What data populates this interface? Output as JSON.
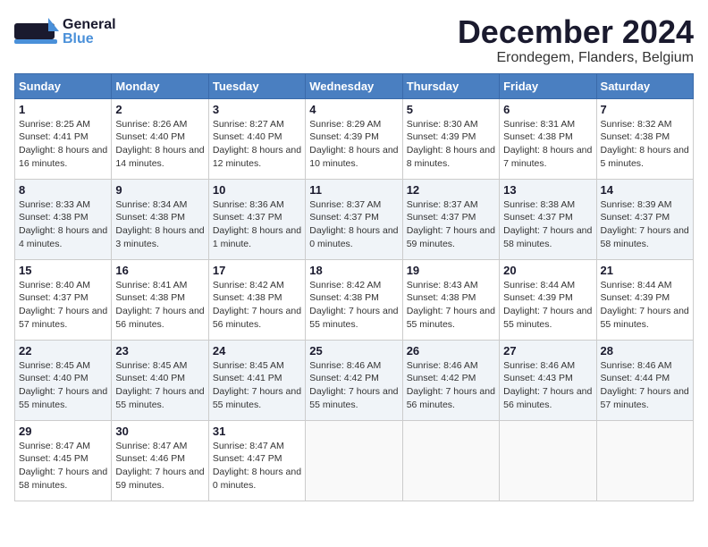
{
  "header": {
    "logo_general": "General",
    "logo_blue": "Blue",
    "month_title": "December 2024",
    "location": "Erondegem, Flanders, Belgium"
  },
  "days_of_week": [
    "Sunday",
    "Monday",
    "Tuesday",
    "Wednesday",
    "Thursday",
    "Friday",
    "Saturday"
  ],
  "weeks": [
    [
      {
        "day": "1",
        "sunrise": "Sunrise: 8:25 AM",
        "sunset": "Sunset: 4:41 PM",
        "daylight": "Daylight: 8 hours and 16 minutes."
      },
      {
        "day": "2",
        "sunrise": "Sunrise: 8:26 AM",
        "sunset": "Sunset: 4:40 PM",
        "daylight": "Daylight: 8 hours and 14 minutes."
      },
      {
        "day": "3",
        "sunrise": "Sunrise: 8:27 AM",
        "sunset": "Sunset: 4:40 PM",
        "daylight": "Daylight: 8 hours and 12 minutes."
      },
      {
        "day": "4",
        "sunrise": "Sunrise: 8:29 AM",
        "sunset": "Sunset: 4:39 PM",
        "daylight": "Daylight: 8 hours and 10 minutes."
      },
      {
        "day": "5",
        "sunrise": "Sunrise: 8:30 AM",
        "sunset": "Sunset: 4:39 PM",
        "daylight": "Daylight: 8 hours and 8 minutes."
      },
      {
        "day": "6",
        "sunrise": "Sunrise: 8:31 AM",
        "sunset": "Sunset: 4:38 PM",
        "daylight": "Daylight: 8 hours and 7 minutes."
      },
      {
        "day": "7",
        "sunrise": "Sunrise: 8:32 AM",
        "sunset": "Sunset: 4:38 PM",
        "daylight": "Daylight: 8 hours and 5 minutes."
      }
    ],
    [
      {
        "day": "8",
        "sunrise": "Sunrise: 8:33 AM",
        "sunset": "Sunset: 4:38 PM",
        "daylight": "Daylight: 8 hours and 4 minutes."
      },
      {
        "day": "9",
        "sunrise": "Sunrise: 8:34 AM",
        "sunset": "Sunset: 4:38 PM",
        "daylight": "Daylight: 8 hours and 3 minutes."
      },
      {
        "day": "10",
        "sunrise": "Sunrise: 8:36 AM",
        "sunset": "Sunset: 4:37 PM",
        "daylight": "Daylight: 8 hours and 1 minute."
      },
      {
        "day": "11",
        "sunrise": "Sunrise: 8:37 AM",
        "sunset": "Sunset: 4:37 PM",
        "daylight": "Daylight: 8 hours and 0 minutes."
      },
      {
        "day": "12",
        "sunrise": "Sunrise: 8:37 AM",
        "sunset": "Sunset: 4:37 PM",
        "daylight": "Daylight: 7 hours and 59 minutes."
      },
      {
        "day": "13",
        "sunrise": "Sunrise: 8:38 AM",
        "sunset": "Sunset: 4:37 PM",
        "daylight": "Daylight: 7 hours and 58 minutes."
      },
      {
        "day": "14",
        "sunrise": "Sunrise: 8:39 AM",
        "sunset": "Sunset: 4:37 PM",
        "daylight": "Daylight: 7 hours and 58 minutes."
      }
    ],
    [
      {
        "day": "15",
        "sunrise": "Sunrise: 8:40 AM",
        "sunset": "Sunset: 4:37 PM",
        "daylight": "Daylight: 7 hours and 57 minutes."
      },
      {
        "day": "16",
        "sunrise": "Sunrise: 8:41 AM",
        "sunset": "Sunset: 4:38 PM",
        "daylight": "Daylight: 7 hours and 56 minutes."
      },
      {
        "day": "17",
        "sunrise": "Sunrise: 8:42 AM",
        "sunset": "Sunset: 4:38 PM",
        "daylight": "Daylight: 7 hours and 56 minutes."
      },
      {
        "day": "18",
        "sunrise": "Sunrise: 8:42 AM",
        "sunset": "Sunset: 4:38 PM",
        "daylight": "Daylight: 7 hours and 55 minutes."
      },
      {
        "day": "19",
        "sunrise": "Sunrise: 8:43 AM",
        "sunset": "Sunset: 4:38 PM",
        "daylight": "Daylight: 7 hours and 55 minutes."
      },
      {
        "day": "20",
        "sunrise": "Sunrise: 8:44 AM",
        "sunset": "Sunset: 4:39 PM",
        "daylight": "Daylight: 7 hours and 55 minutes."
      },
      {
        "day": "21",
        "sunrise": "Sunrise: 8:44 AM",
        "sunset": "Sunset: 4:39 PM",
        "daylight": "Daylight: 7 hours and 55 minutes."
      }
    ],
    [
      {
        "day": "22",
        "sunrise": "Sunrise: 8:45 AM",
        "sunset": "Sunset: 4:40 PM",
        "daylight": "Daylight: 7 hours and 55 minutes."
      },
      {
        "day": "23",
        "sunrise": "Sunrise: 8:45 AM",
        "sunset": "Sunset: 4:40 PM",
        "daylight": "Daylight: 7 hours and 55 minutes."
      },
      {
        "day": "24",
        "sunrise": "Sunrise: 8:45 AM",
        "sunset": "Sunset: 4:41 PM",
        "daylight": "Daylight: 7 hours and 55 minutes."
      },
      {
        "day": "25",
        "sunrise": "Sunrise: 8:46 AM",
        "sunset": "Sunset: 4:42 PM",
        "daylight": "Daylight: 7 hours and 55 minutes."
      },
      {
        "day": "26",
        "sunrise": "Sunrise: 8:46 AM",
        "sunset": "Sunset: 4:42 PM",
        "daylight": "Daylight: 7 hours and 56 minutes."
      },
      {
        "day": "27",
        "sunrise": "Sunrise: 8:46 AM",
        "sunset": "Sunset: 4:43 PM",
        "daylight": "Daylight: 7 hours and 56 minutes."
      },
      {
        "day": "28",
        "sunrise": "Sunrise: 8:46 AM",
        "sunset": "Sunset: 4:44 PM",
        "daylight": "Daylight: 7 hours and 57 minutes."
      }
    ],
    [
      {
        "day": "29",
        "sunrise": "Sunrise: 8:47 AM",
        "sunset": "Sunset: 4:45 PM",
        "daylight": "Daylight: 7 hours and 58 minutes."
      },
      {
        "day": "30",
        "sunrise": "Sunrise: 8:47 AM",
        "sunset": "Sunset: 4:46 PM",
        "daylight": "Daylight: 7 hours and 59 minutes."
      },
      {
        "day": "31",
        "sunrise": "Sunrise: 8:47 AM",
        "sunset": "Sunset: 4:47 PM",
        "daylight": "Daylight: 8 hours and 0 minutes."
      },
      null,
      null,
      null,
      null
    ]
  ]
}
